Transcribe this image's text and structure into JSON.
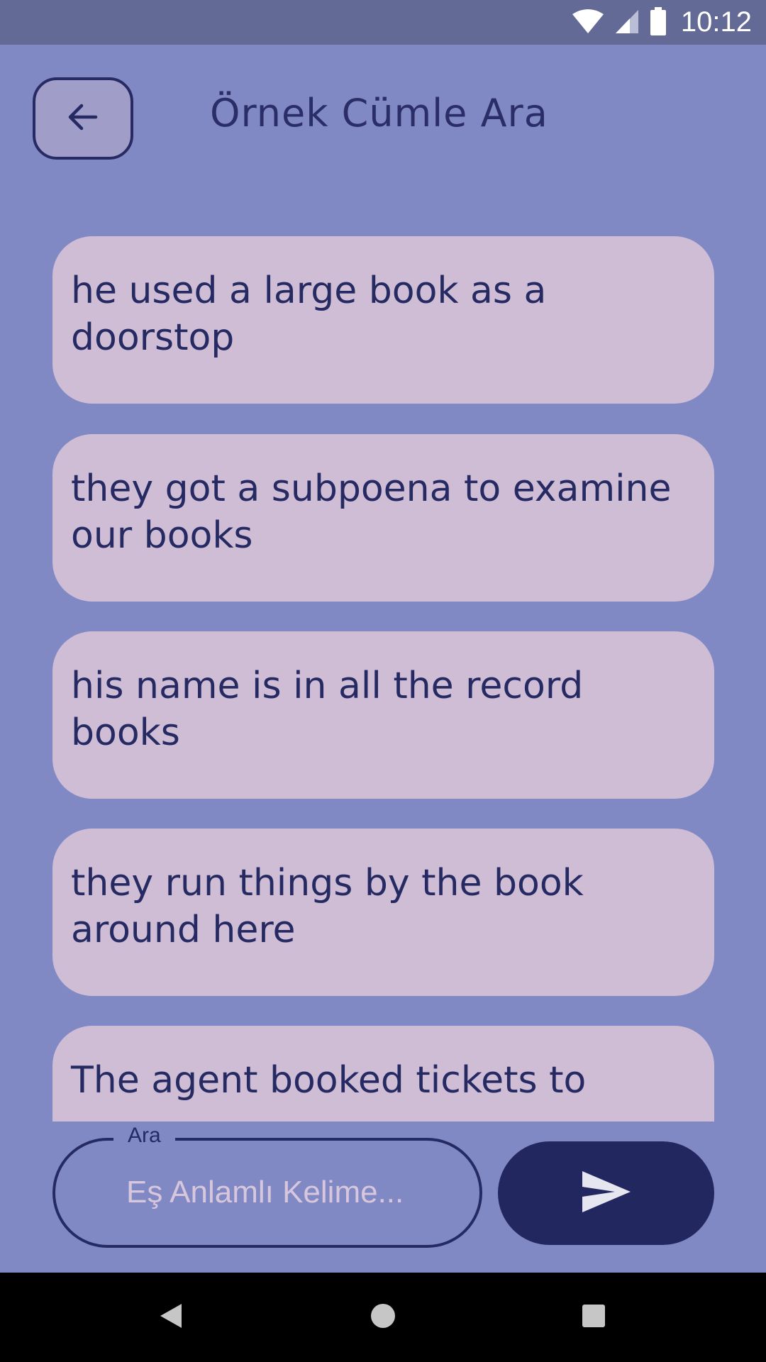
{
  "status_bar": {
    "time": "10:12",
    "icons": [
      "wifi-icon",
      "cell-signal-icon",
      "battery-icon"
    ]
  },
  "header": {
    "back_icon": "arrow-left-icon",
    "title": "Örnek Cümle Ara"
  },
  "sentences": [
    "he used a large book as a doorstop",
    "they got a subpoena to examine our books",
    "his name is in all the record books",
    "they run things by the book around here",
    "The agent booked tickets to"
  ],
  "search": {
    "label": "Ara",
    "placeholder": "Eş Anlamlı Kelime...",
    "value": "",
    "send_icon": "send-icon"
  },
  "nav_bar": {
    "icons": [
      "back-triangle-icon",
      "home-circle-icon",
      "recents-square-icon"
    ]
  },
  "colors": {
    "background": "#8189c5",
    "status_bar": "#646a96",
    "card": "#cfbcd5",
    "text": "#262a62",
    "accent": "#232760",
    "placeholder": "#d7c6dc"
  }
}
